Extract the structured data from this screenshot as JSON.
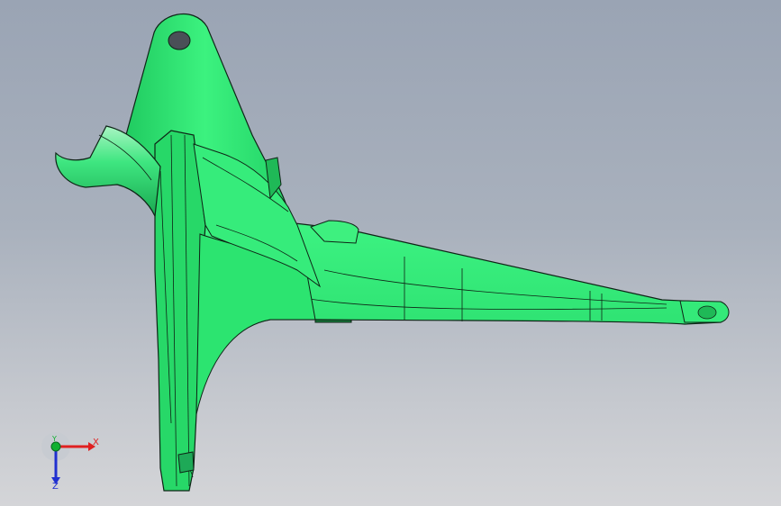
{
  "viewport": {
    "background_top": "#9aa4b4",
    "background_bottom": "#d4d5d8"
  },
  "model": {
    "part_color": "#2ee872",
    "part_shade": "#1fb957",
    "edge_color": "#0e2416"
  },
  "triad": {
    "x_label": "X",
    "y_label": "Y",
    "z_label": "Z",
    "x_color": "#e02020",
    "y_color": "#10b030",
    "z_color": "#2030d0"
  }
}
